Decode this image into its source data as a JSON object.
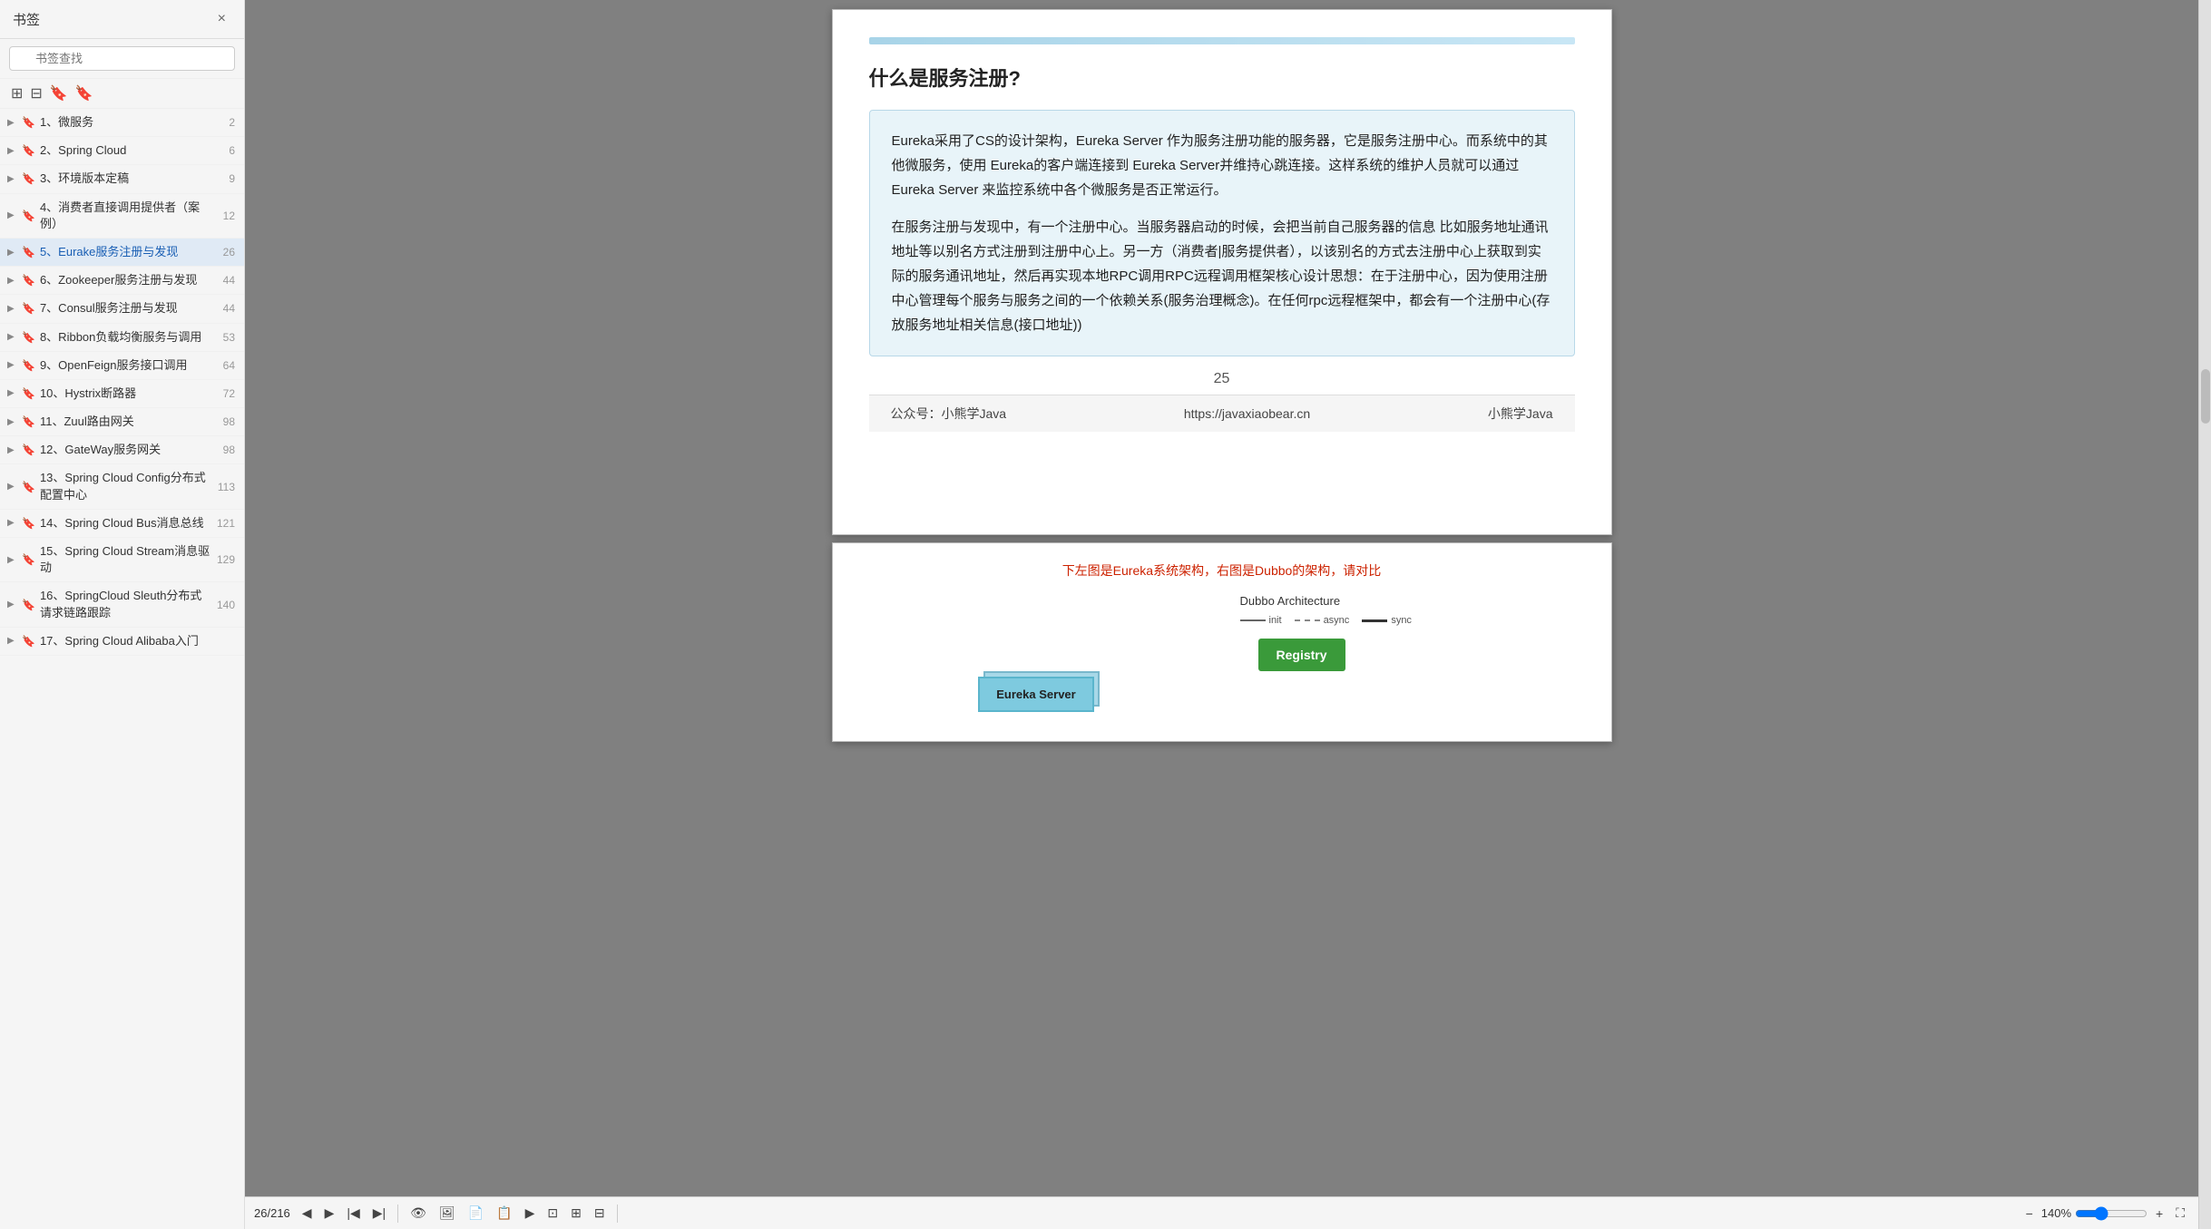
{
  "sidebar": {
    "title": "书签",
    "close_label": "×",
    "search_placeholder": "书签查找",
    "icons": [
      "⊞",
      "⊟",
      "🔖",
      "🔖"
    ],
    "items": [
      {
        "id": 1,
        "label": "1、微服务",
        "page": "2",
        "active": false,
        "arrow": "▶"
      },
      {
        "id": 2,
        "label": "2、Spring Cloud",
        "page": "6",
        "active": false,
        "arrow": "▶"
      },
      {
        "id": 3,
        "label": "3、环境版本定稿",
        "page": "9",
        "active": false,
        "arrow": "▶"
      },
      {
        "id": 4,
        "label": "4、消费者直接调用提供者（案例）",
        "page": "12",
        "active": false,
        "arrow": "▶"
      },
      {
        "id": 5,
        "label": "5、Eurake服务注册与发现",
        "page": "26",
        "active": true,
        "arrow": "▶"
      },
      {
        "id": 6,
        "label": "6、Zookeeper服务注册与发现",
        "page": "44",
        "active": false,
        "arrow": "▶"
      },
      {
        "id": 7,
        "label": "7、Consul服务注册与发现",
        "page": "44",
        "active": false,
        "arrow": "▶"
      },
      {
        "id": 8,
        "label": "8、Ribbon负载均衡服务与调用",
        "page": "53",
        "active": false,
        "arrow": "▶"
      },
      {
        "id": 9,
        "label": "9、OpenFeign服务接口调用",
        "page": "64",
        "active": false,
        "arrow": "▶"
      },
      {
        "id": 10,
        "label": "10、Hystrix断路器",
        "page": "72",
        "active": false,
        "arrow": "▶"
      },
      {
        "id": 11,
        "label": "11、Zuul路由网关",
        "page": "98",
        "active": false,
        "arrow": "▶"
      },
      {
        "id": 12,
        "label": "12、GateWay服务网关",
        "page": "98",
        "active": false,
        "arrow": "▶"
      },
      {
        "id": 13,
        "label": "13、Spring Cloud Config分布式配置中心",
        "page": "113",
        "active": false,
        "arrow": "▶"
      },
      {
        "id": 14,
        "label": "14、Spring Cloud Bus消息总线",
        "page": "121",
        "active": false,
        "arrow": "▶"
      },
      {
        "id": 15,
        "label": "15、Spring Cloud Stream消息驱动",
        "page": "129",
        "active": false,
        "arrow": "▶"
      },
      {
        "id": 16,
        "label": "16、SpringCloud Sleuth分布式请求链路跟踪",
        "page": "140",
        "active": false,
        "arrow": "▶"
      },
      {
        "id": 17,
        "label": "17、Spring Cloud Alibaba入门",
        "page": "",
        "active": false,
        "arrow": "▶"
      }
    ]
  },
  "page": {
    "current": "26",
    "total": "216",
    "section_title": "什么是服务注册?",
    "info_paragraph1": "Eureka采用了CS的设计架构，Eureka Server 作为服务注册功能的服务器，它是服务注册中心。而系统中的其他微服务，使用 Eureka的客户端连接到 Eureka Server并维持心跳连接。这样系统的维护人员就可以通过 Eureka Server 来监控系统中各个微服务是否正常运行。",
    "info_paragraph2": "在服务注册与发现中，有一个注册中心。当服务器启动的时候，会把当前自己服务器的信息 比如服务地址通讯地址等以别名方式注册到注册中心上。另一方（消费者|服务提供者），以该别名的方式去注册中心上获取到实际的服务通讯地址，然后再实现本地RPC调用RPC远程调用框架核心设计思想：在于注册中心，因为使用注册中心管理每个服务与服务之间的一个依赖关系(服务治理概念)。在任何rpc远程框架中，都会有一个注册中心(存放服务地址相关信息(接口地址))",
    "page_number": "25",
    "footer_left": "公众号：小熊学Java",
    "footer_center": "https://javaxiaobear.cn",
    "footer_right": "小熊学Java"
  },
  "page2": {
    "diagram_caption": "下左图是Eureka系统架构，右图是Dubbo的架构，请对比",
    "eureka_server_label": "Eureka Server",
    "dubbo_title": "Dubbo Architecture",
    "dubbo_legend_init": "init",
    "dubbo_legend_async": "async",
    "dubbo_legend_sync": "sync",
    "registry_label": "Registry"
  },
  "toolbar": {
    "page_current": "26",
    "page_total": "216",
    "zoom_level": "140%",
    "zoom_minus": "−",
    "zoom_plus": "+"
  }
}
